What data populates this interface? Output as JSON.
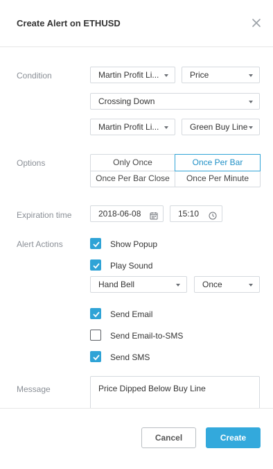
{
  "dialog": {
    "title": "Create Alert on ETHUSD"
  },
  "condition": {
    "label": "Condition",
    "source": "Martin Profit Li...",
    "field": "Price",
    "operator": "Crossing Down",
    "target_source": "Martin Profit Li...",
    "target_field": "Green Buy Line"
  },
  "options": {
    "label": "Options",
    "items": [
      "Only Once",
      "Once Per Bar",
      "Once Per Bar Close",
      "Once Per Minute"
    ],
    "selected": "Once Per Bar"
  },
  "expiration": {
    "label": "Expiration time",
    "date": "2018-06-08",
    "time": "15:10"
  },
  "actions": {
    "label": "Alert Actions",
    "show_popup": {
      "label": "Show Popup",
      "checked": true
    },
    "play_sound": {
      "label": "Play Sound",
      "checked": true
    },
    "sound": "Hand Bell",
    "sound_repeat": "Once",
    "send_email": {
      "label": "Send Email",
      "checked": true
    },
    "send_email_sms": {
      "label": "Send Email-to-SMS",
      "checked": false
    },
    "send_sms": {
      "label": "Send SMS",
      "checked": true
    }
  },
  "message": {
    "label": "Message",
    "value": "Price Dipped Below Buy Line"
  },
  "footer": {
    "cancel_label": "Cancel",
    "create_label": "Create"
  },
  "colors": {
    "accent": "#2fa3d6",
    "create_button": "#33a9dc"
  }
}
